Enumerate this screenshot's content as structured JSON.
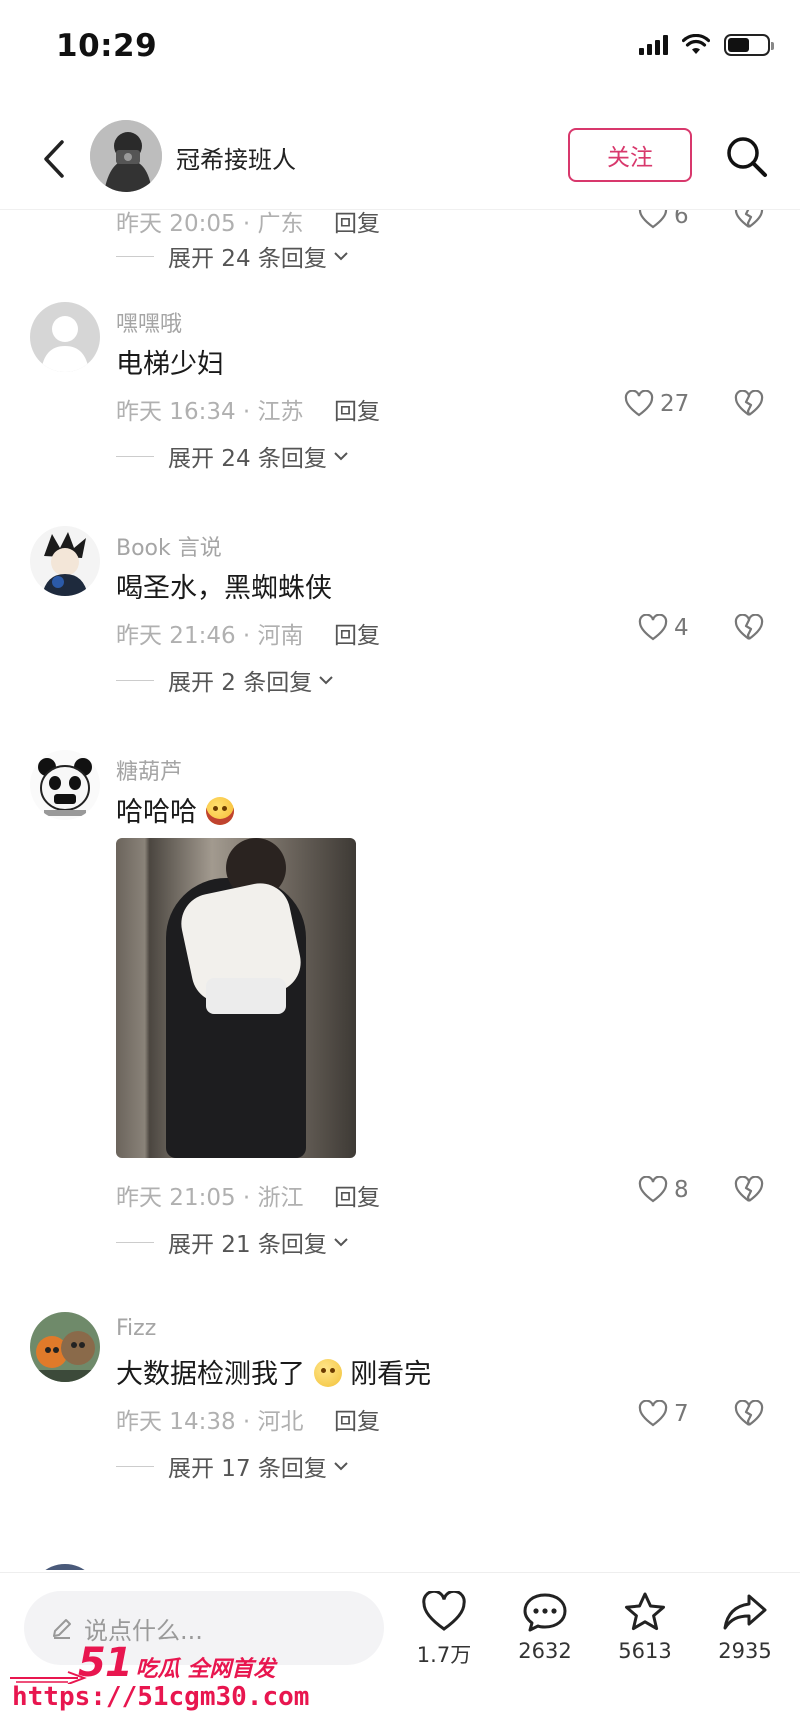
{
  "status_bar": {
    "time": "10:29"
  },
  "header": {
    "author_name": "冠希接班人",
    "follow_label": "关注"
  },
  "comments": [
    {
      "id": "prev",
      "username": "",
      "text": "",
      "time": "昨天 20:05 · 广东",
      "reply_label": "回复",
      "likes": "6",
      "expand": "展开 24 条回复"
    },
    {
      "id": "c1",
      "username": "嘿嘿哦",
      "text": "电梯少妇",
      "time": "昨天 16:34 · 江苏",
      "reply_label": "回复",
      "likes": "27",
      "expand": "展开 24 条回复"
    },
    {
      "id": "c2",
      "username": "Book 言说",
      "text": "喝圣水，黑蜘蛛侠",
      "time": "昨天 21:46 · 河南",
      "reply_label": "回复",
      "likes": "4",
      "expand": "展开 2 条回复"
    },
    {
      "id": "c3",
      "username": "糖葫芦",
      "text": "哈哈哈",
      "time": "昨天 21:05 · 浙江",
      "reply_label": "回复",
      "likes": "8",
      "expand": "展开 21 条回复"
    },
    {
      "id": "c4",
      "username": "Fizz",
      "text_before": "大数据检测我了",
      "text_after": "刚看完",
      "time": "昨天 14:38 · 河北",
      "reply_label": "回复",
      "likes": "7",
      "expand": "展开 17 条回复"
    }
  ],
  "bottom_bar": {
    "input_placeholder": "说点什么...",
    "likes": "1.7万",
    "comments": "2632",
    "favorites": "5613",
    "shares": "2935"
  },
  "watermark": {
    "brand_number": "51",
    "brand_text": "吃瓜 全网首发",
    "url": "https://51cgm30.com"
  },
  "colors": {
    "accent": "#d8386c",
    "watermark": "#e8164f",
    "muted": "#b0b0b0"
  }
}
